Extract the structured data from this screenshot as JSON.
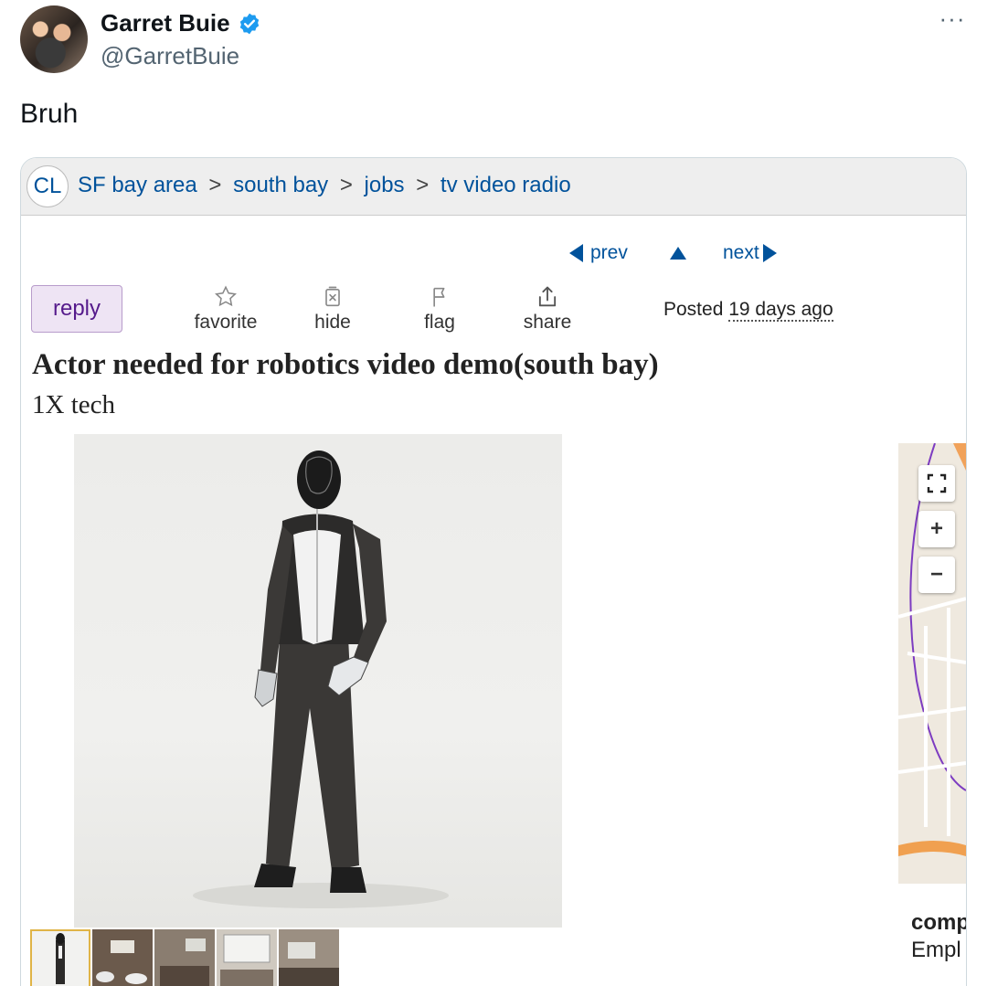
{
  "tweet": {
    "author_name": "Garret Buie",
    "author_handle": "@GarretBuie",
    "more_label": "···",
    "text": "Bruh",
    "verified_color": "#1d9bf0"
  },
  "listing": {
    "logo": "CL",
    "breadcrumbs": [
      {
        "label": "SF bay area"
      },
      {
        "label": "south bay"
      },
      {
        "label": "jobs"
      },
      {
        "label": "tv video radio"
      }
    ],
    "breadcrumb_separator": ">",
    "nav": {
      "prev": "prev",
      "next": "next"
    },
    "reply_label": "reply",
    "actions": {
      "favorite": "favorite",
      "hide": "hide",
      "flag": "flag",
      "share": "share"
    },
    "posted_prefix": "Posted",
    "posted_ago": "19 days ago",
    "title": "Actor needed for robotics video demo(south bay)",
    "subtitle": "1X tech",
    "map_controls": {
      "zoom_in": "+",
      "zoom_out": "−"
    },
    "compensation_label": "comp",
    "employment_label": "Empl"
  },
  "colors": {
    "link": "#00529b",
    "reply_bg": "#eee4f4",
    "reply_text": "#551a8b",
    "thumb_active_border": "#e0b447"
  }
}
